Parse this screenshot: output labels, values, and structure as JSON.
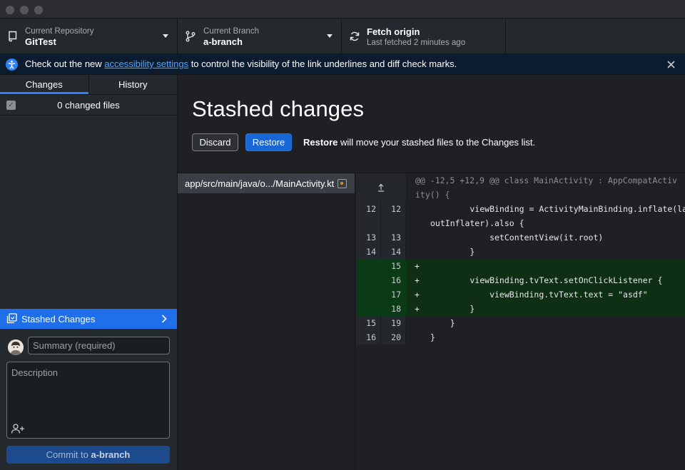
{
  "window": {},
  "toolbar": {
    "repo_label": "Current Repository",
    "repo_value": "GitTest",
    "branch_label": "Current Branch",
    "branch_value": "a-branch",
    "fetch_label": "Fetch origin",
    "fetch_sub": "Last fetched 2 minutes ago"
  },
  "banner": {
    "pre": "Check out the new ",
    "link": "accessibility settings",
    "post": " to control the visibility of the link underlines and diff check marks."
  },
  "sidebar": {
    "tabs": [
      "Changes",
      "History"
    ],
    "changed_files": "0 changed files",
    "stashed_label": "Stashed Changes",
    "summary_placeholder": "Summary (required)",
    "description_placeholder": "Description",
    "commit_prefix": "Commit to ",
    "commit_branch": "a-branch"
  },
  "main": {
    "title": "Stashed changes",
    "discard_label": "Discard",
    "restore_label": "Restore",
    "hint_bold": "Restore",
    "hint_rest": " will move your stashed files to the Changes list.",
    "file_path": "app/src/main/java/o.../MainActivity.kt"
  },
  "diff": {
    "hunk_header_1": "@@ -12,5 +12,9 @@ class MainActivity : AppCompatActiv",
    "hunk_header_2": "ity() {",
    "lines": [
      {
        "old": "12",
        "new": "12",
        "sign": "",
        "text": "        viewBinding = ActivityMainBinding.inflate(lay",
        "type": "ctx"
      },
      {
        "old": "",
        "new": "",
        "sign": "",
        "text": "outInflater).also {",
        "type": "ctx"
      },
      {
        "old": "13",
        "new": "13",
        "sign": "",
        "text": "            setContentView(it.root)",
        "type": "ctx"
      },
      {
        "old": "14",
        "new": "14",
        "sign": "",
        "text": "        }",
        "type": "ctx"
      },
      {
        "old": "",
        "new": "15",
        "sign": "+",
        "text": "",
        "type": "add"
      },
      {
        "old": "",
        "new": "16",
        "sign": "+",
        "text": "        viewBinding.tvText.setOnClickListener {",
        "type": "add"
      },
      {
        "old": "",
        "new": "17",
        "sign": "+",
        "text": "            viewBinding.tvText.text = \"asdf\"",
        "type": "add"
      },
      {
        "old": "",
        "new": "18",
        "sign": "+",
        "text": "        }",
        "type": "add"
      },
      {
        "old": "15",
        "new": "19",
        "sign": "",
        "text": "    }",
        "type": "ctx"
      },
      {
        "old": "16",
        "new": "20",
        "sign": "",
        "text": "}",
        "type": "ctx"
      }
    ]
  },
  "colors": {
    "accent": "#1f6feb",
    "added_bg": "#0f2f14",
    "banner_bg": "#0d1b2e"
  }
}
